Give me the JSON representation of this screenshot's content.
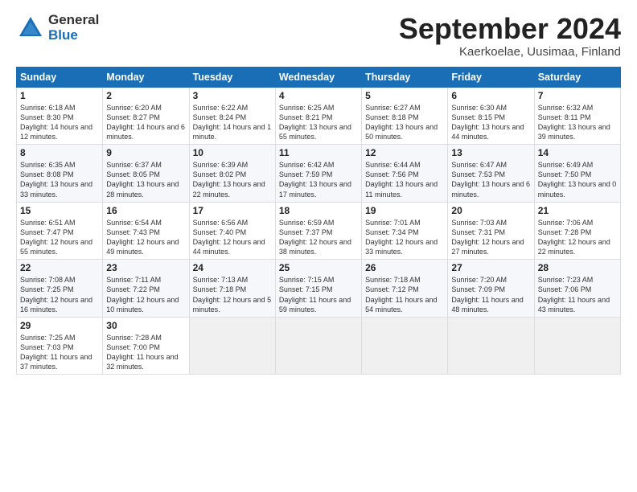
{
  "logo": {
    "general": "General",
    "blue": "Blue"
  },
  "title": "September 2024",
  "subtitle": "Kaerkoelae, Uusimaa, Finland",
  "headers": [
    "Sunday",
    "Monday",
    "Tuesday",
    "Wednesday",
    "Thursday",
    "Friday",
    "Saturday"
  ],
  "weeks": [
    [
      {
        "day": "1",
        "sunrise": "Sunrise: 6:18 AM",
        "sunset": "Sunset: 8:30 PM",
        "daylight": "Daylight: 14 hours and 12 minutes."
      },
      {
        "day": "2",
        "sunrise": "Sunrise: 6:20 AM",
        "sunset": "Sunset: 8:27 PM",
        "daylight": "Daylight: 14 hours and 6 minutes."
      },
      {
        "day": "3",
        "sunrise": "Sunrise: 6:22 AM",
        "sunset": "Sunset: 8:24 PM",
        "daylight": "Daylight: 14 hours and 1 minute."
      },
      {
        "day": "4",
        "sunrise": "Sunrise: 6:25 AM",
        "sunset": "Sunset: 8:21 PM",
        "daylight": "Daylight: 13 hours and 55 minutes."
      },
      {
        "day": "5",
        "sunrise": "Sunrise: 6:27 AM",
        "sunset": "Sunset: 8:18 PM",
        "daylight": "Daylight: 13 hours and 50 minutes."
      },
      {
        "day": "6",
        "sunrise": "Sunrise: 6:30 AM",
        "sunset": "Sunset: 8:15 PM",
        "daylight": "Daylight: 13 hours and 44 minutes."
      },
      {
        "day": "7",
        "sunrise": "Sunrise: 6:32 AM",
        "sunset": "Sunset: 8:11 PM",
        "daylight": "Daylight: 13 hours and 39 minutes."
      }
    ],
    [
      {
        "day": "8",
        "sunrise": "Sunrise: 6:35 AM",
        "sunset": "Sunset: 8:08 PM",
        "daylight": "Daylight: 13 hours and 33 minutes."
      },
      {
        "day": "9",
        "sunrise": "Sunrise: 6:37 AM",
        "sunset": "Sunset: 8:05 PM",
        "daylight": "Daylight: 13 hours and 28 minutes."
      },
      {
        "day": "10",
        "sunrise": "Sunrise: 6:39 AM",
        "sunset": "Sunset: 8:02 PM",
        "daylight": "Daylight: 13 hours and 22 minutes."
      },
      {
        "day": "11",
        "sunrise": "Sunrise: 6:42 AM",
        "sunset": "Sunset: 7:59 PM",
        "daylight": "Daylight: 13 hours and 17 minutes."
      },
      {
        "day": "12",
        "sunrise": "Sunrise: 6:44 AM",
        "sunset": "Sunset: 7:56 PM",
        "daylight": "Daylight: 13 hours and 11 minutes."
      },
      {
        "day": "13",
        "sunrise": "Sunrise: 6:47 AM",
        "sunset": "Sunset: 7:53 PM",
        "daylight": "Daylight: 13 hours and 6 minutes."
      },
      {
        "day": "14",
        "sunrise": "Sunrise: 6:49 AM",
        "sunset": "Sunset: 7:50 PM",
        "daylight": "Daylight: 13 hours and 0 minutes."
      }
    ],
    [
      {
        "day": "15",
        "sunrise": "Sunrise: 6:51 AM",
        "sunset": "Sunset: 7:47 PM",
        "daylight": "Daylight: 12 hours and 55 minutes."
      },
      {
        "day": "16",
        "sunrise": "Sunrise: 6:54 AM",
        "sunset": "Sunset: 7:43 PM",
        "daylight": "Daylight: 12 hours and 49 minutes."
      },
      {
        "day": "17",
        "sunrise": "Sunrise: 6:56 AM",
        "sunset": "Sunset: 7:40 PM",
        "daylight": "Daylight: 12 hours and 44 minutes."
      },
      {
        "day": "18",
        "sunrise": "Sunrise: 6:59 AM",
        "sunset": "Sunset: 7:37 PM",
        "daylight": "Daylight: 12 hours and 38 minutes."
      },
      {
        "day": "19",
        "sunrise": "Sunrise: 7:01 AM",
        "sunset": "Sunset: 7:34 PM",
        "daylight": "Daylight: 12 hours and 33 minutes."
      },
      {
        "day": "20",
        "sunrise": "Sunrise: 7:03 AM",
        "sunset": "Sunset: 7:31 PM",
        "daylight": "Daylight: 12 hours and 27 minutes."
      },
      {
        "day": "21",
        "sunrise": "Sunrise: 7:06 AM",
        "sunset": "Sunset: 7:28 PM",
        "daylight": "Daylight: 12 hours and 22 minutes."
      }
    ],
    [
      {
        "day": "22",
        "sunrise": "Sunrise: 7:08 AM",
        "sunset": "Sunset: 7:25 PM",
        "daylight": "Daylight: 12 hours and 16 minutes."
      },
      {
        "day": "23",
        "sunrise": "Sunrise: 7:11 AM",
        "sunset": "Sunset: 7:22 PM",
        "daylight": "Daylight: 12 hours and 10 minutes."
      },
      {
        "day": "24",
        "sunrise": "Sunrise: 7:13 AM",
        "sunset": "Sunset: 7:18 PM",
        "daylight": "Daylight: 12 hours and 5 minutes."
      },
      {
        "day": "25",
        "sunrise": "Sunrise: 7:15 AM",
        "sunset": "Sunset: 7:15 PM",
        "daylight": "Daylight: 11 hours and 59 minutes."
      },
      {
        "day": "26",
        "sunrise": "Sunrise: 7:18 AM",
        "sunset": "Sunset: 7:12 PM",
        "daylight": "Daylight: 11 hours and 54 minutes."
      },
      {
        "day": "27",
        "sunrise": "Sunrise: 7:20 AM",
        "sunset": "Sunset: 7:09 PM",
        "daylight": "Daylight: 11 hours and 48 minutes."
      },
      {
        "day": "28",
        "sunrise": "Sunrise: 7:23 AM",
        "sunset": "Sunset: 7:06 PM",
        "daylight": "Daylight: 11 hours and 43 minutes."
      }
    ],
    [
      {
        "day": "29",
        "sunrise": "Sunrise: 7:25 AM",
        "sunset": "Sunset: 7:03 PM",
        "daylight": "Daylight: 11 hours and 37 minutes."
      },
      {
        "day": "30",
        "sunrise": "Sunrise: 7:28 AM",
        "sunset": "Sunset: 7:00 PM",
        "daylight": "Daylight: 11 hours and 32 minutes."
      },
      null,
      null,
      null,
      null,
      null
    ]
  ]
}
